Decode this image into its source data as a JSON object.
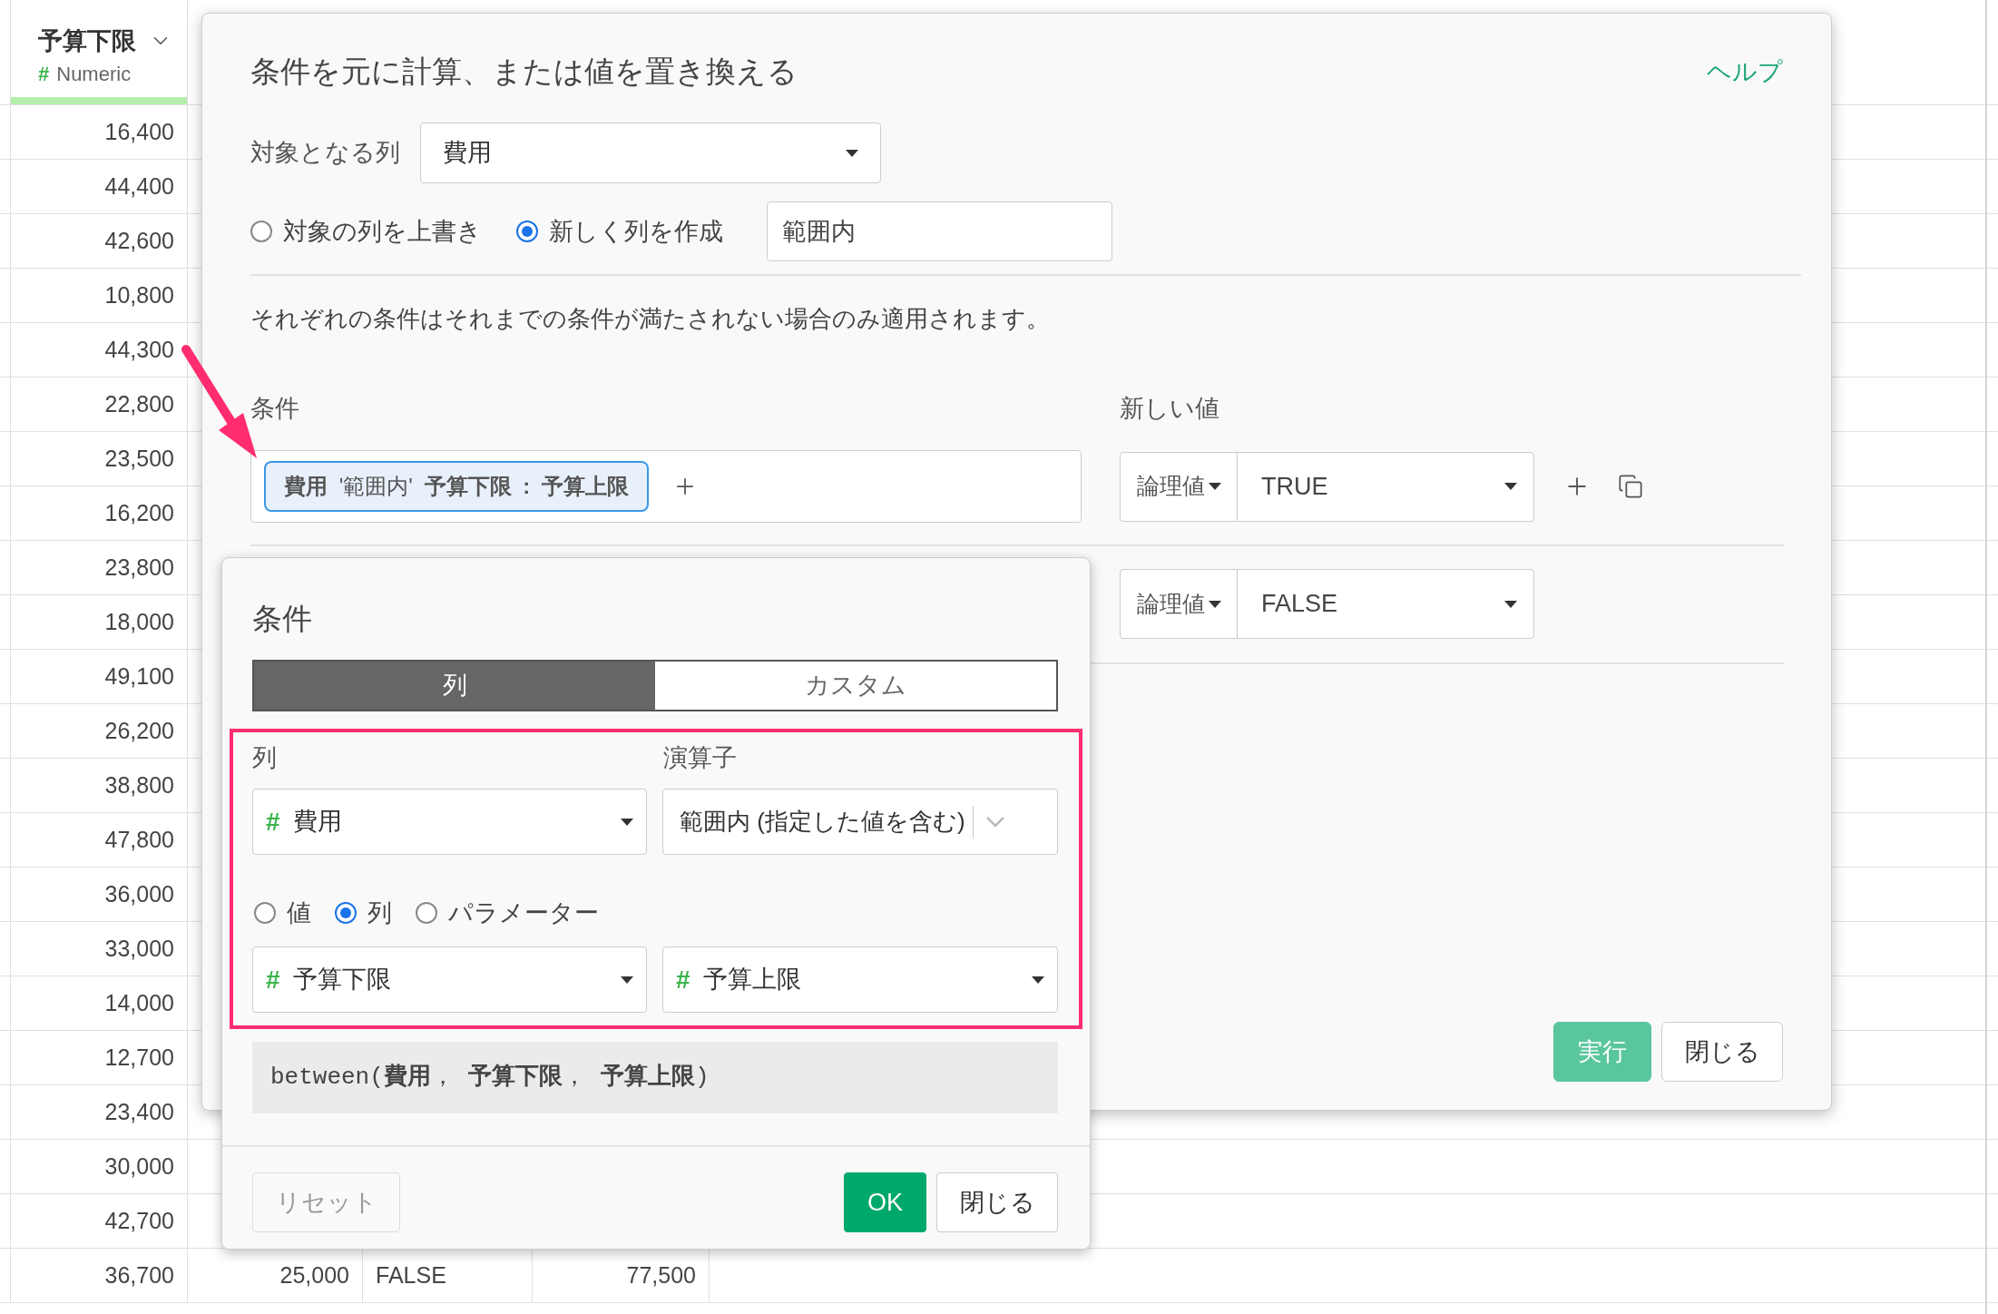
{
  "table": {
    "header": {
      "title": "予算下限",
      "type_mark": "#",
      "type": "Numeric"
    },
    "rows": [
      {
        "column_1": "16,400"
      },
      {
        "column_1": "44,400"
      },
      {
        "column_1": "42,600"
      },
      {
        "column_1": "10,800"
      },
      {
        "column_1": "44,300"
      },
      {
        "column_1": "22,800"
      },
      {
        "column_1": "23,500"
      },
      {
        "column_1": "16,200"
      },
      {
        "column_1": "23,800"
      },
      {
        "column_1": "18,000"
      },
      {
        "column_1": "49,100"
      },
      {
        "column_1": "26,200"
      },
      {
        "column_1": "38,800"
      },
      {
        "column_1": "47,800"
      },
      {
        "column_1": "36,000"
      },
      {
        "column_1": "33,000"
      },
      {
        "column_1": "14,000"
      },
      {
        "column_1": "12,700"
      },
      {
        "column_1": "23,400"
      },
      {
        "column_1": "30,000"
      },
      {
        "column_1": "42,700"
      },
      {
        "column_1": "36,700",
        "column_2": "25,000",
        "column_3": "FALSE",
        "column_4": "77,500"
      }
    ]
  },
  "dialog": {
    "title": "条件を元に計算、または値を置き換える",
    "help_link": "ヘルプ",
    "target_label": "対象となる列",
    "target_select": "費用",
    "modes": [
      {
        "label": "対象の列を上書き",
        "selected": false
      },
      {
        "label": "新しく列を作成",
        "selected": true
      }
    ],
    "new_column_name": "範囲内",
    "note": "それぞれの条件はそれまでの条件が満たされない場合のみ適用されます。",
    "conditions_header": "条件",
    "new_value_header": "新しい値",
    "rules": [
      {
        "condition_chip": "**費用** '範囲内' **予算下限 : 予算上限**",
        "value_type": "論理値",
        "value": "TRUE"
      },
      {
        "value_type": "論理値",
        "value": "FALSE"
      }
    ],
    "buttons": [
      {
        "label": "実行",
        "kind": "primary"
      },
      {
        "label": "閉じる",
        "kind": "default"
      }
    ]
  },
  "popup": {
    "title": "条件",
    "tabs": [
      {
        "label": "列",
        "selected": true
      },
      {
        "label": "カスタム",
        "selected": false
      }
    ],
    "column_label": "列",
    "operator_label": "演算子",
    "column_select": {
      "type_mark": "#",
      "value": "費用"
    },
    "operator_select": "範囲内 (指定した値を含む)",
    "compare_modes": [
      {
        "label": "値",
        "selected": false
      },
      {
        "label": "列",
        "selected": true
      },
      {
        "label": "パラメーター",
        "selected": false
      }
    ],
    "range_selects": [
      {
        "type_mark": "#",
        "value": "予算下限"
      },
      {
        "type_mark": "#",
        "value": "予算上限"
      }
    ],
    "formula": "between(**費用**， **予算下限**， **予算上限**)",
    "buttons": [
      {
        "label": "リセット",
        "kind": "disabled"
      },
      {
        "label": "OK",
        "kind": "ok"
      },
      {
        "label": "閉じる",
        "kind": "default"
      }
    ]
  }
}
